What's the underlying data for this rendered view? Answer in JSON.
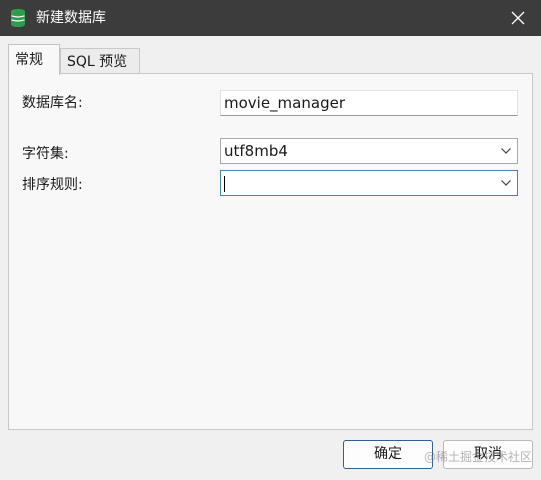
{
  "window": {
    "title": "新建数据库"
  },
  "tabs": [
    {
      "label": "常规"
    },
    {
      "label": "SQL 预览"
    }
  ],
  "form": {
    "name_label": "数据库名:",
    "name_value": "movie_manager",
    "charset_label": "字符集:",
    "charset_value": "utf8mb4",
    "collation_label": "排序规则:",
    "collation_value": ""
  },
  "buttons": {
    "ok": "确定",
    "cancel": "取消"
  },
  "watermark": "@稀土掘金技术社区",
  "colors": {
    "titlebar": "#3c3c3c",
    "app_icon": "#2e9e4e",
    "focus_border": "#4a7fb5"
  }
}
